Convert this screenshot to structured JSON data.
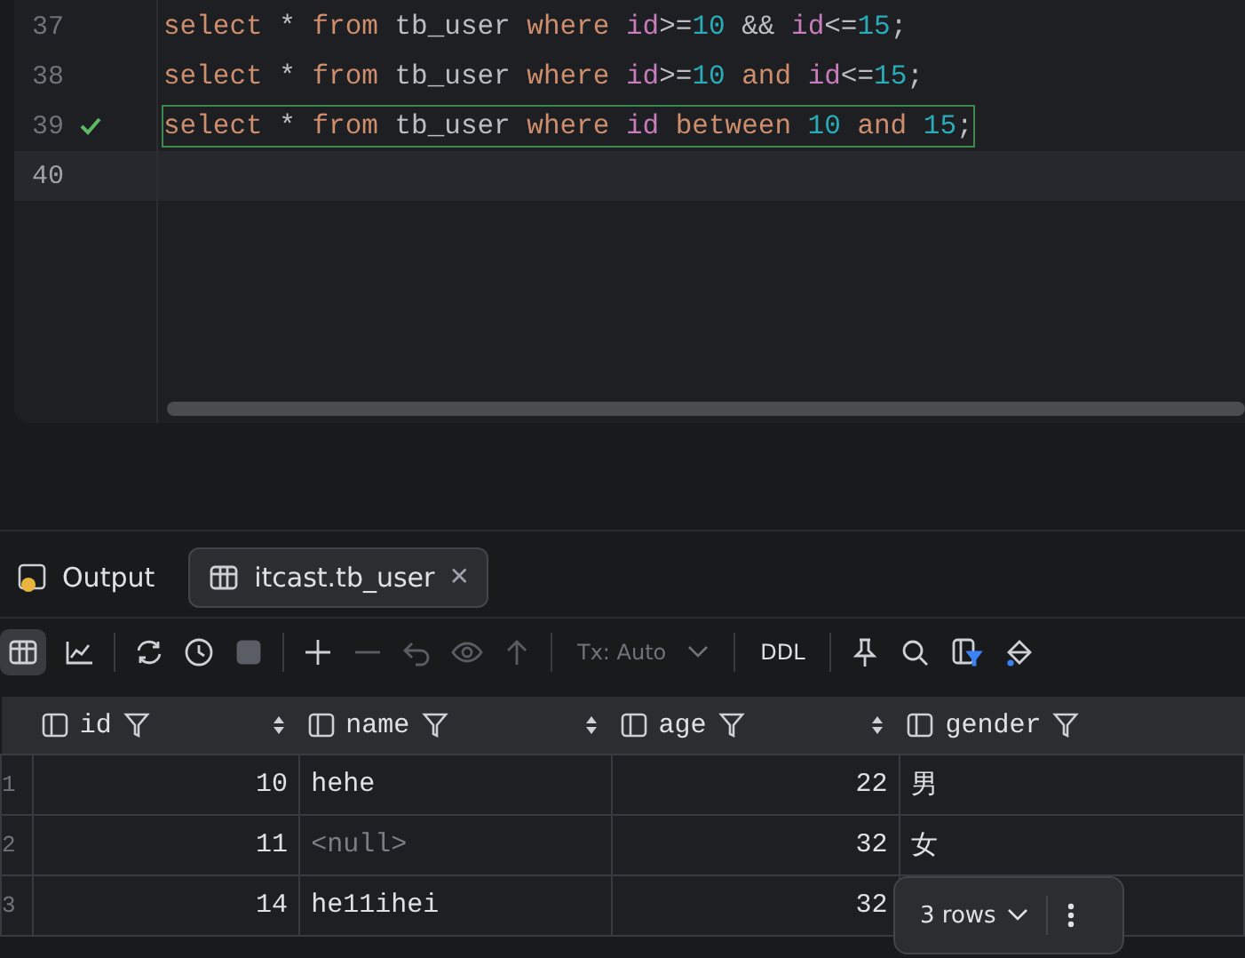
{
  "editor": {
    "lines": [
      {
        "number": "37",
        "current": false,
        "ok": false,
        "tokens": [
          {
            "text": "select",
            "kind": "kw"
          },
          {
            "text": " * ",
            "kind": "plain"
          },
          {
            "text": "from",
            "kind": "kw"
          },
          {
            "text": " tb_user ",
            "kind": "plain"
          },
          {
            "text": "where",
            "kind": "kw"
          },
          {
            "text": " id",
            "kind": "col"
          },
          {
            "text": ">=",
            "kind": "plain"
          },
          {
            "text": "10",
            "kind": "num"
          },
          {
            "text": " && ",
            "kind": "plain"
          },
          {
            "text": "id",
            "kind": "col"
          },
          {
            "text": "<=",
            "kind": "plain"
          },
          {
            "text": "15",
            "kind": "num"
          },
          {
            "text": ";",
            "kind": "plain"
          }
        ]
      },
      {
        "number": "38",
        "current": false,
        "ok": false,
        "tokens": [
          {
            "text": "select",
            "kind": "kw"
          },
          {
            "text": " * ",
            "kind": "plain"
          },
          {
            "text": "from",
            "kind": "kw"
          },
          {
            "text": " tb_user ",
            "kind": "plain"
          },
          {
            "text": "where",
            "kind": "kw"
          },
          {
            "text": " id",
            "kind": "col"
          },
          {
            "text": ">=",
            "kind": "plain"
          },
          {
            "text": "10",
            "kind": "num"
          },
          {
            "text": " and",
            "kind": "kw"
          },
          {
            "text": " id",
            "kind": "col"
          },
          {
            "text": "<=",
            "kind": "plain"
          },
          {
            "text": "15",
            "kind": "num"
          },
          {
            "text": ";",
            "kind": "plain"
          }
        ]
      },
      {
        "number": "39",
        "current": false,
        "ok": true,
        "tokens": [
          {
            "text": "select",
            "kind": "kw"
          },
          {
            "text": " * ",
            "kind": "plain"
          },
          {
            "text": "from",
            "kind": "kw"
          },
          {
            "text": " tb_user ",
            "kind": "plain"
          },
          {
            "text": "where",
            "kind": "kw"
          },
          {
            "text": " id",
            "kind": "col"
          },
          {
            "text": " between",
            "kind": "kw"
          },
          {
            "text": " 10",
            "kind": "num"
          },
          {
            "text": " and",
            "kind": "kw"
          },
          {
            "text": " 15",
            "kind": "num"
          },
          {
            "text": ";",
            "kind": "plain"
          }
        ]
      },
      {
        "number": "40",
        "current": true,
        "ok": false
      }
    ]
  },
  "tabs": [
    {
      "label": "Output",
      "selected": false
    },
    {
      "label": "itcast.tb_user",
      "selected": true,
      "close": "✕"
    }
  ],
  "toolbar": {
    "tx": {
      "label": "Tx: Auto",
      "disabled": true
    },
    "ddl": "DDL"
  },
  "table": {
    "columns": [
      "id",
      "name",
      "age",
      "gender"
    ],
    "rows": [
      {
        "number": "1",
        "cells": [
          "10",
          "hehe",
          "22",
          "男"
        ]
      },
      {
        "number": "2",
        "cells": [
          "11",
          "<null>",
          "32",
          "女"
        ]
      },
      {
        "number": "3",
        "cells": [
          "14",
          "he11ihei",
          "32",
          null
        ]
      }
    ]
  },
  "rows_popup": {
    "label": "3 rows"
  }
}
